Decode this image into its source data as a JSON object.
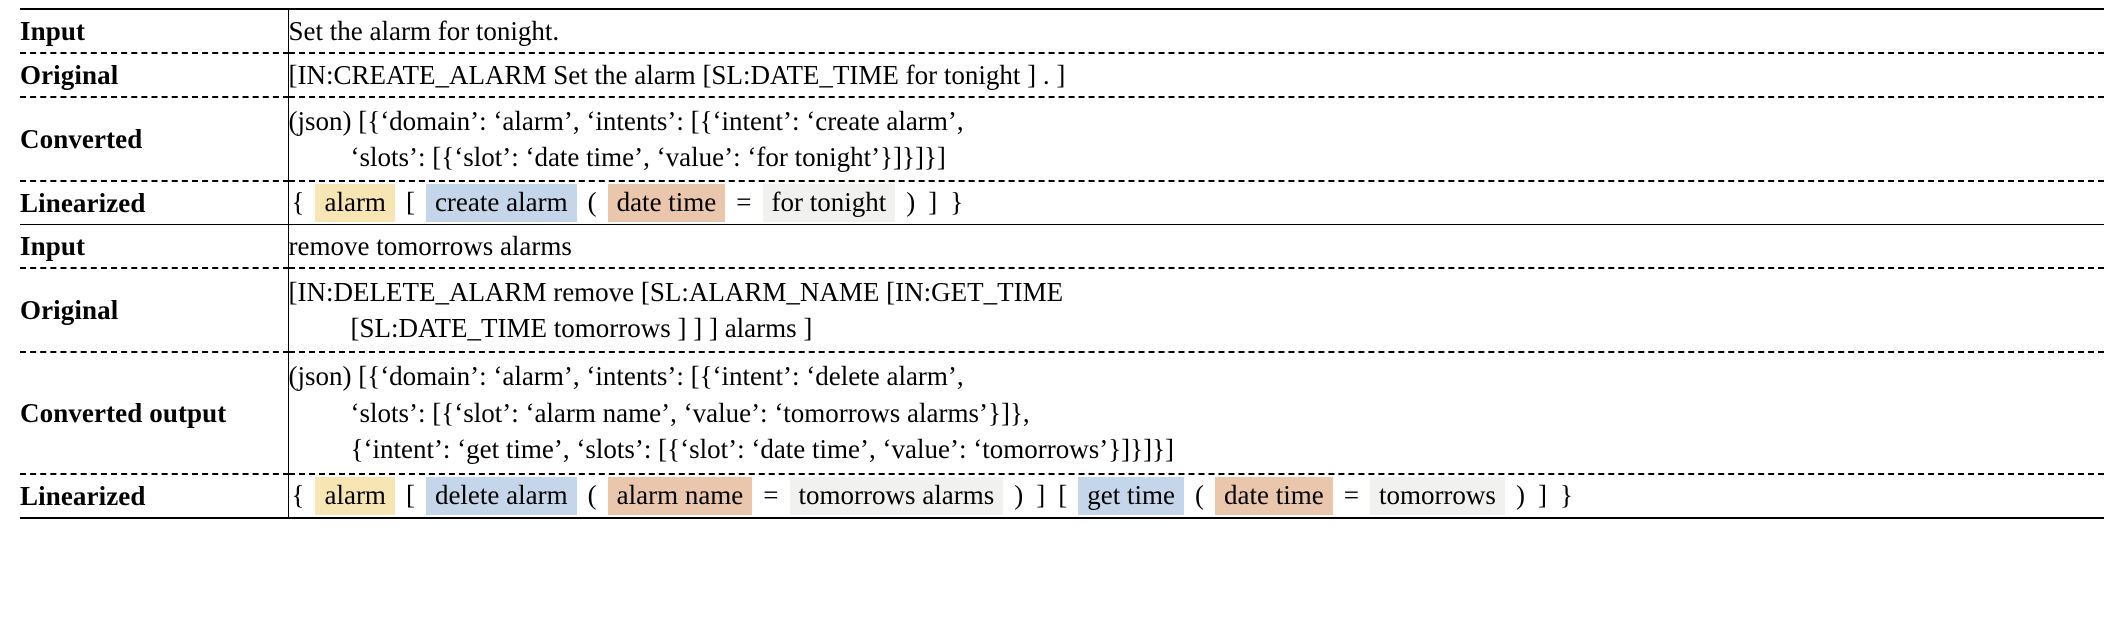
{
  "colors": {
    "domain_highlight": "#f7e6b4",
    "intent_highlight": "#c6d6ea",
    "slot_highlight": "#eac7ac",
    "value_highlight": "#f1f1ef",
    "rule": "#000000",
    "background": "#ffffff"
  },
  "labels": {
    "input": "Input",
    "original": "Original",
    "converted": "Converted",
    "converted_output": "Converted output",
    "linearized": "Linearized"
  },
  "examples": [
    {
      "input": "Set the alarm for tonight.",
      "original": [
        "[IN:CREATE_ALARM Set the alarm [SL:DATE_TIME for tonight ] . ]"
      ],
      "converted": [
        "(json) [{‘domain’: ‘alarm’, ‘intents’: [{‘intent’: ‘create alarm’,",
        "‘slots’: [{‘slot’: ‘date time’, ‘value’: ‘for tonight’}]}]}]"
      ],
      "linearized_tokens": [
        {
          "text": "{",
          "style": "plain"
        },
        {
          "text": "alarm",
          "style": "domain"
        },
        {
          "text": "[",
          "style": "plain"
        },
        {
          "text": "create alarm",
          "style": "intent"
        },
        {
          "text": "(",
          "style": "plain"
        },
        {
          "text": "date time",
          "style": "slot"
        },
        {
          "text": "=",
          "style": "plain"
        },
        {
          "text": "for tonight",
          "style": "value"
        },
        {
          "text": ")",
          "style": "plain"
        },
        {
          "text": "]",
          "style": "plain"
        },
        {
          "text": "}",
          "style": "plain"
        }
      ]
    },
    {
      "input": "remove tomorrows alarms",
      "original": [
        "[IN:DELETE_ALARM remove [SL:ALARM_NAME [IN:GET_TIME",
        "[SL:DATE_TIME tomorrows ] ] ] alarms ]"
      ],
      "converted": [
        "(json) [{‘domain’: ‘alarm’, ‘intents’: [{‘intent’: ‘delete alarm’,",
        "‘slots’: [{‘slot’: ‘alarm name’, ‘value’: ‘tomorrows alarms’}]},",
        "{‘intent’: ‘get time’, ‘slots’: [{‘slot’: ‘date time’, ‘value’: ‘tomorrows’}]}]}]"
      ],
      "linearized_tokens": [
        {
          "text": "{",
          "style": "plain"
        },
        {
          "text": "alarm",
          "style": "domain"
        },
        {
          "text": "[",
          "style": "plain"
        },
        {
          "text": "delete alarm",
          "style": "intent"
        },
        {
          "text": "(",
          "style": "plain"
        },
        {
          "text": "alarm name",
          "style": "slot"
        },
        {
          "text": "=",
          "style": "plain"
        },
        {
          "text": "tomorrows alarms",
          "style": "value"
        },
        {
          "text": ")",
          "style": "plain"
        },
        {
          "text": "]",
          "style": "plain"
        },
        {
          "text": "[",
          "style": "plain"
        },
        {
          "text": "get time",
          "style": "intent"
        },
        {
          "text": "(",
          "style": "plain"
        },
        {
          "text": "date time",
          "style": "slot"
        },
        {
          "text": "=",
          "style": "plain"
        },
        {
          "text": "tomorrows",
          "style": "value"
        },
        {
          "text": ")",
          "style": "plain"
        },
        {
          "text": "]",
          "style": "plain"
        },
        {
          "text": "}",
          "style": "plain"
        }
      ]
    }
  ]
}
